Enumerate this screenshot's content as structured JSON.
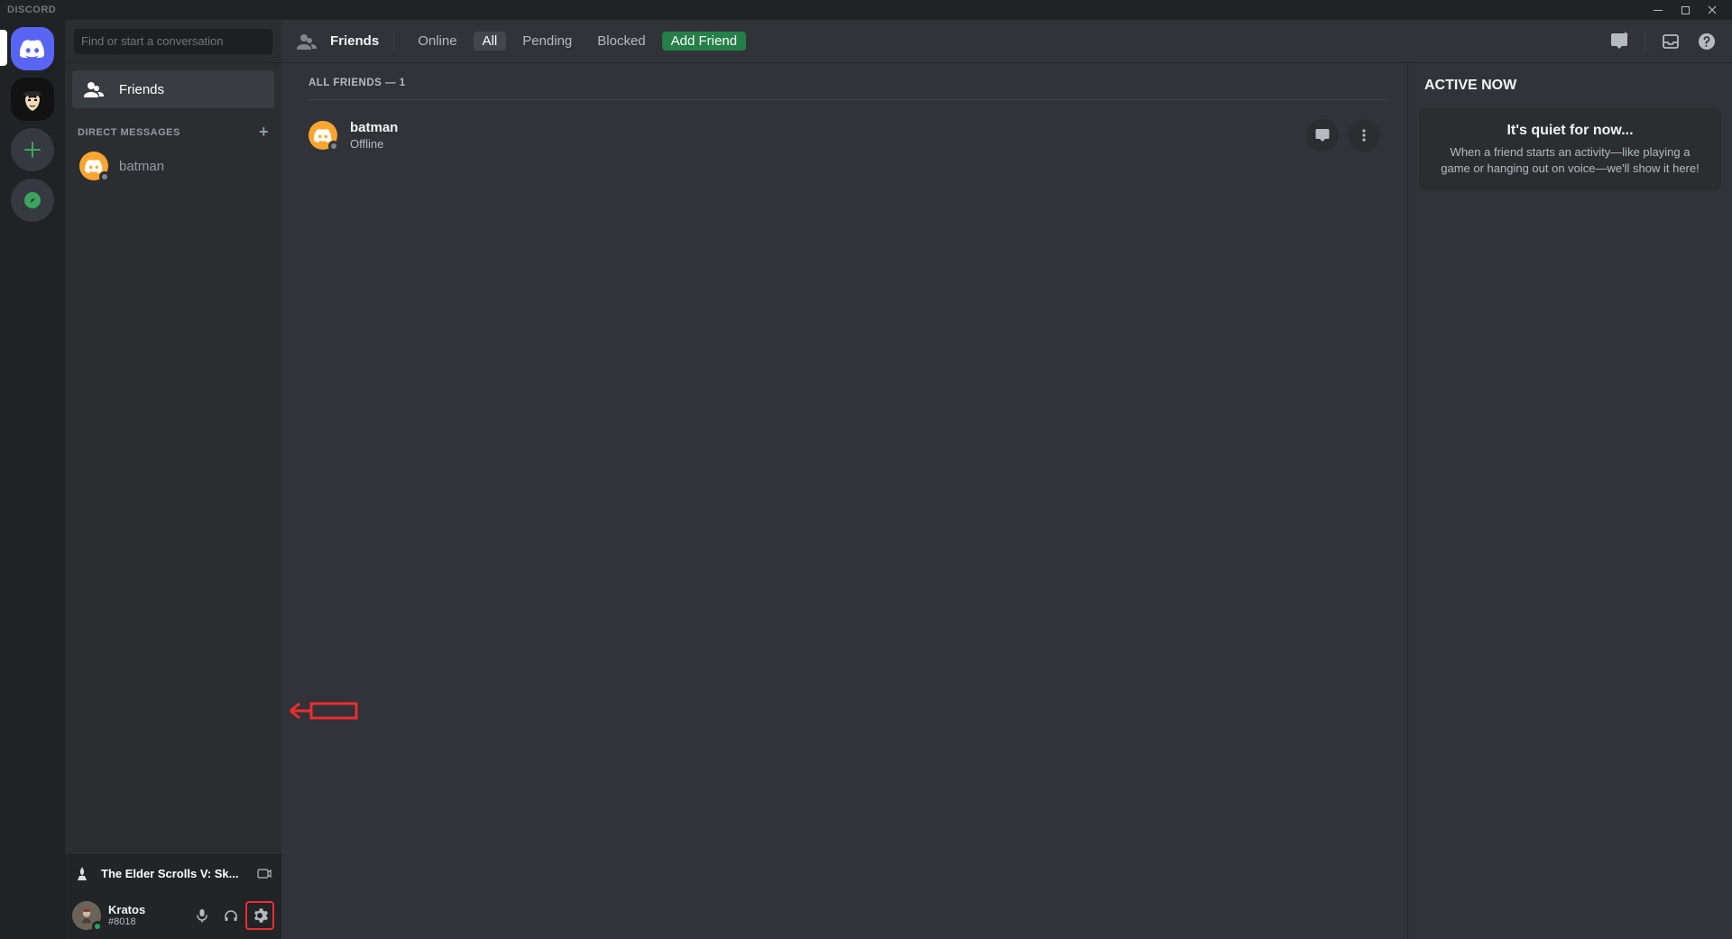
{
  "titleBar": {
    "brand": "DISCORD"
  },
  "search": {
    "placeholder": "Find or start a conversation"
  },
  "sidebar": {
    "friendsLabel": "Friends",
    "dmHeader": "DIRECT MESSAGES",
    "dmItems": [
      {
        "name": "batman"
      }
    ]
  },
  "playing": {
    "title": "The Elder Scrolls V: Sk..."
  },
  "user": {
    "name": "Kratos",
    "tag": "#8018"
  },
  "topTabs": {
    "friendsLabel": "Friends",
    "online": "Online",
    "all": "All",
    "pending": "Pending",
    "blocked": "Blocked",
    "addFriend": "Add Friend"
  },
  "list": {
    "header": "ALL FRIENDS — 1",
    "friends": [
      {
        "name": "batman",
        "status": "Offline"
      }
    ]
  },
  "activeNow": {
    "title": "ACTIVE NOW",
    "cardTitle": "It's quiet for now...",
    "cardBody": "When a friend starts an activity—like playing a game or hanging out on voice—we'll show it here!"
  }
}
